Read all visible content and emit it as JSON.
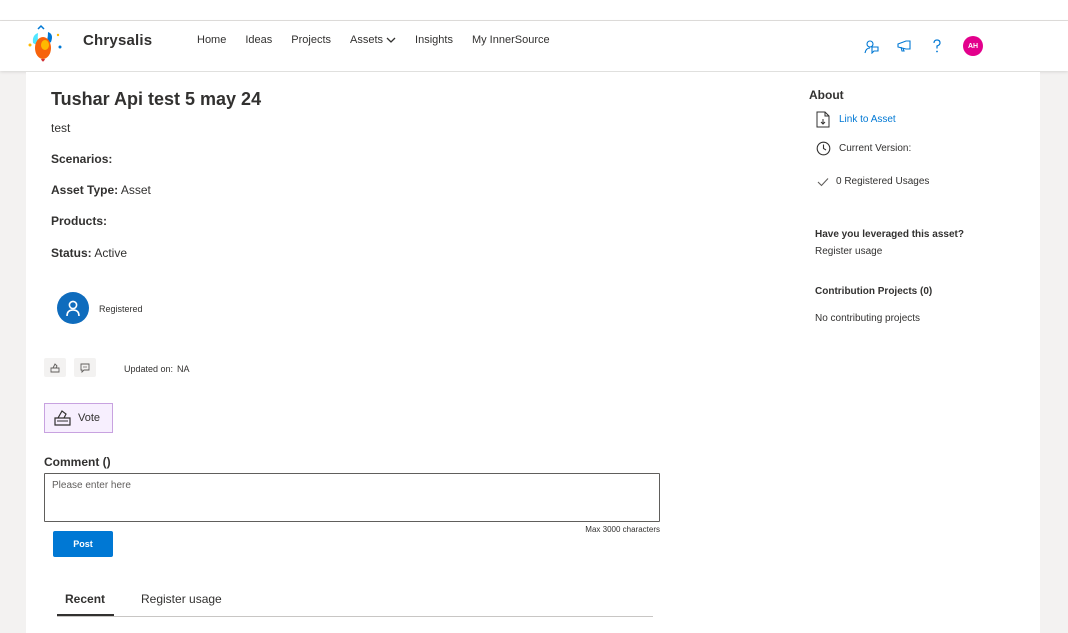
{
  "app": {
    "name": "Chrysalis"
  },
  "nav": {
    "items": [
      "Home",
      "Ideas",
      "Projects",
      "Assets",
      "Insights",
      "My InnerSource"
    ]
  },
  "header": {
    "icons": [
      "feedback-icon",
      "announcement-icon",
      "help-icon"
    ],
    "avatar_initials": "AH",
    "avatar_color": "#e3008c"
  },
  "asset": {
    "title": "Tushar Api test 5 may 24",
    "description": "test",
    "scenarios_label": "Scenarios:",
    "scenarios_value": "",
    "type_label": "Asset Type:",
    "type_value": "Asset",
    "products_label": "Products:",
    "products_value": "",
    "status_label": "Status:",
    "status_value": "Active",
    "registered_label": "Registered",
    "updated_label": "Updated on:",
    "updated_value": "NA"
  },
  "vote": {
    "label": "Vote"
  },
  "comment": {
    "label": "Comment ()",
    "placeholder": "Please enter here",
    "max_chars": "Max 3000 characters",
    "post_label": "Post"
  },
  "tabs": [
    "Recent",
    "Register usage"
  ],
  "about": {
    "title": "About",
    "link_to_asset": "Link to Asset",
    "current_version": "Current Version:",
    "registered_usages": "0 Registered Usages",
    "leveraged_question": "Have you leveraged this asset?",
    "register_usage_link": "Register usage",
    "contribution_projects": "Contribution Projects (0)",
    "no_contributing": "No contributing projects"
  },
  "colors": {
    "primary": "#0078d4",
    "vote_bg": "#f7effe",
    "vote_border": "#c8a2e0"
  }
}
